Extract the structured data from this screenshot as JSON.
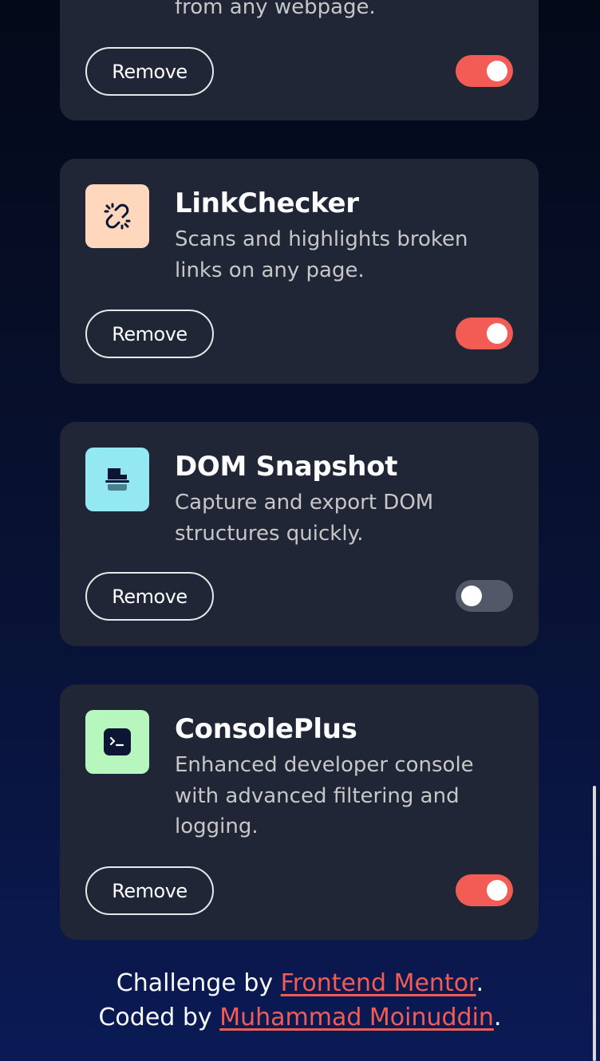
{
  "extensions": [
    {
      "id": "partial-top",
      "name": "",
      "description": "from any webpage.",
      "remove_label": "Remove",
      "active": true
    },
    {
      "id": "linkchecker",
      "name": "LinkChecker",
      "description": "Scans and highlights broken links on any page.",
      "remove_label": "Remove",
      "active": true,
      "icon": "broken-link-icon",
      "icon_bg": "#ffd7bd"
    },
    {
      "id": "dom-snapshot",
      "name": "DOM Snapshot",
      "description": "Capture and export DOM structures quickly.",
      "remove_label": "Remove",
      "active": false,
      "icon": "snapshot-icon",
      "icon_bg": "#93e8f2"
    },
    {
      "id": "consoleplus",
      "name": "ConsolePlus",
      "description": "Enhanced developer console with advanced filtering and logging.",
      "remove_label": "Remove",
      "active": true,
      "icon": "terminal-icon",
      "icon_bg": "#b7f7bd"
    }
  ],
  "footer": {
    "challenge_prefix": "Challenge by ",
    "challenge_link": "Frontend Mentor",
    "challenge_suffix": ".",
    "coded_prefix": "Coded by ",
    "coded_link": "Muhammad Moinuddin",
    "coded_suffix": "."
  },
  "colors": {
    "accent": "#f25c54",
    "card_bg": "#212636",
    "toggle_off": "#535868"
  }
}
